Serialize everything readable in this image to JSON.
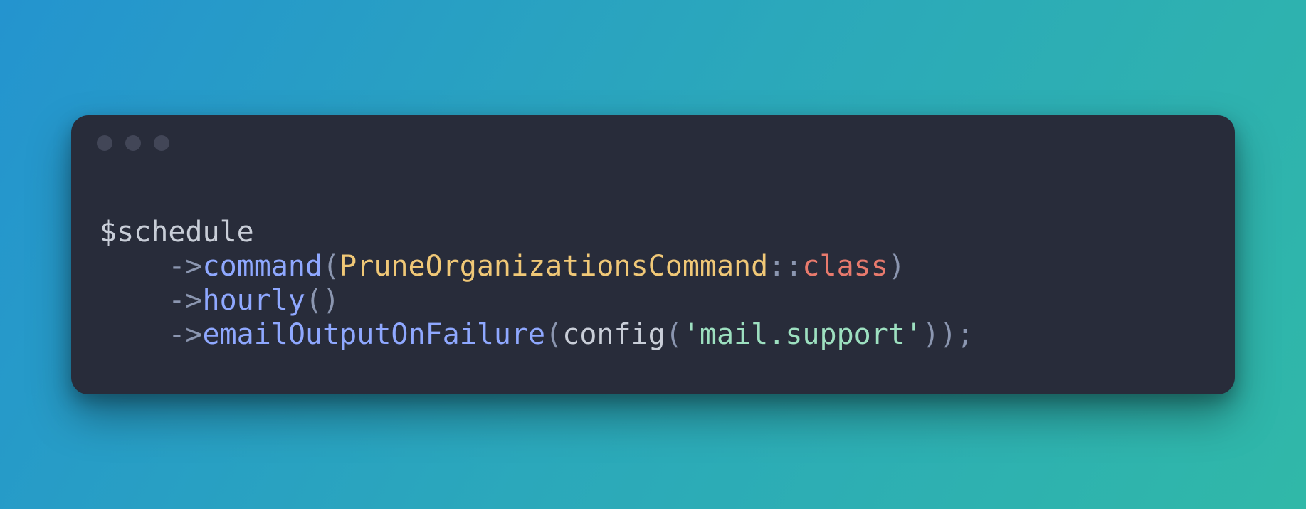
{
  "window": {
    "titlebar": {
      "dots": 3
    }
  },
  "code": {
    "var": "$schedule",
    "arrow": "->",
    "indent": "    ",
    "methods": {
      "command": "command",
      "hourly": "hourly",
      "emailOutputOnFailure": "emailOutputOnFailure",
      "config": "config"
    },
    "class_name": "PruneOrganizationsCommand",
    "scope_op": "::",
    "class_keyword": "class",
    "string": "'mail.support'",
    "paren_open": "(",
    "paren_close": ")",
    "semicolon": ";"
  }
}
